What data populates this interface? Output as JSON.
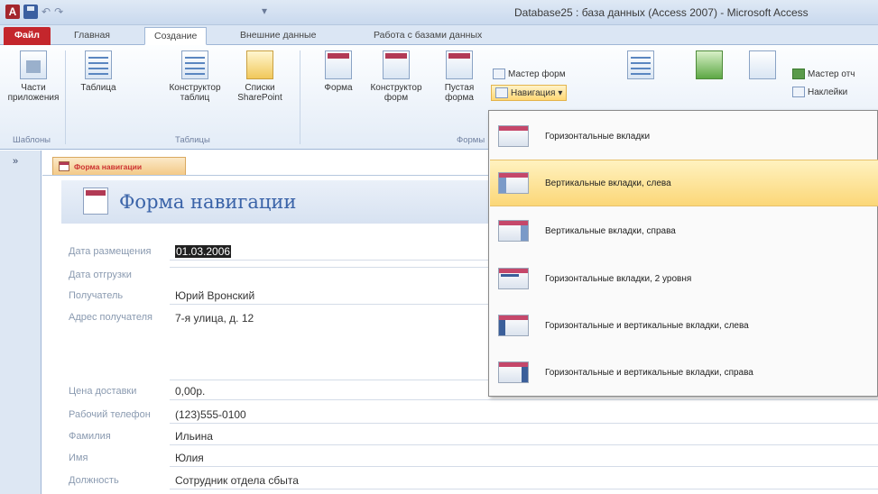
{
  "window": {
    "title": "Database25 : база данных (Access 2007) - Microsoft Access",
    "app_icon_letter": "A"
  },
  "ribbon_tabs": [
    {
      "label": "Файл"
    },
    {
      "label": "Главная"
    },
    {
      "label": "Создание"
    },
    {
      "label": "Внешние данные"
    },
    {
      "label": "Работа с базами данных"
    }
  ],
  "ribbon": {
    "app_parts": "Части приложения",
    "templates_group": "Шаблоны",
    "table": "Таблица",
    "table_designer": "Конструктор таблиц",
    "sp_lists": "Списки SharePoint",
    "tables_group": "Таблицы",
    "form": "Форма",
    "form_designer": "Конструктор форм",
    "blank_form": "Пустая форма",
    "forms_group": "Формы",
    "form_wizard": "Мастер форм",
    "navigation": "Навигация",
    "report_wizard": "Мастер отч",
    "labels": "Наклейки"
  },
  "navigation_menu": [
    {
      "label": "Горизонтальные вкладки",
      "icon": "horizontal-tabs-icon"
    },
    {
      "label": "Вертикальные вкладки, слева",
      "icon": "vertical-tabs-left-icon"
    },
    {
      "label": "Вертикальные вкладки, справа",
      "icon": "vertical-tabs-right-icon"
    },
    {
      "label": "Горизонтальные вкладки, 2 уровня",
      "icon": "horizontal-tabs-2-levels-icon"
    },
    {
      "label": "Горизонтальные и вертикальные вкладки, слева",
      "icon": "horizontal-vertical-left-icon"
    },
    {
      "label": "Горизонтальные и вертикальные вкладки, справа",
      "icon": "horizontal-vertical-right-icon"
    }
  ],
  "navpane": {
    "toggle": "»"
  },
  "document": {
    "tab_label": "Форма навигации",
    "title": "Форма навигации"
  },
  "form_fields": [
    {
      "label": "Дата размещения",
      "value": "01.03.2006"
    },
    {
      "label": "Дата отгрузки",
      "value": ""
    },
    {
      "label": "Получатель",
      "value": "Юрий Вронский"
    },
    {
      "label": "Адрес получателя",
      "value": "7-я улица, д. 12"
    },
    {
      "label": "Цена доставки",
      "value": "0,00р."
    },
    {
      "label": "Рабочий телефон",
      "value": "(123)555-0100"
    },
    {
      "label": "Фамилия",
      "value": "Ильина"
    },
    {
      "label": "Имя",
      "value": "Юлия"
    },
    {
      "label": "Должность",
      "value": "Сотрудник отдела сбыта"
    }
  ]
}
